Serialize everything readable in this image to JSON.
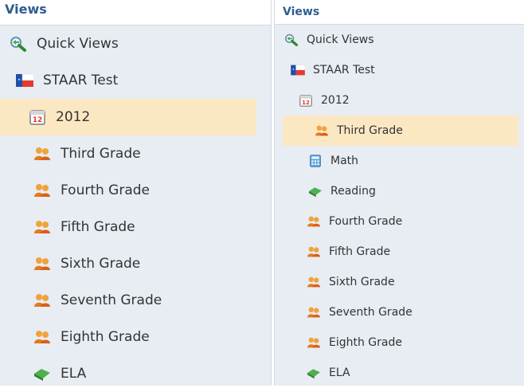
{
  "left": {
    "header": "Views",
    "items": [
      {
        "label": "Quick Views",
        "icon": "magnifier-icon"
      },
      {
        "label": "STAAR Test",
        "icon": "texas-flag-icon"
      },
      {
        "label": "2012",
        "icon": "calendar-icon",
        "selected": true
      },
      {
        "label": "Third Grade",
        "icon": "users-icon"
      },
      {
        "label": "Fourth Grade",
        "icon": "users-icon"
      },
      {
        "label": "Fifth Grade",
        "icon": "users-icon"
      },
      {
        "label": "Sixth Grade",
        "icon": "users-icon"
      },
      {
        "label": "Seventh Grade",
        "icon": "users-icon"
      },
      {
        "label": "Eighth Grade",
        "icon": "users-icon"
      },
      {
        "label": "ELA",
        "icon": "book-icon"
      }
    ]
  },
  "right": {
    "header": "Views",
    "items": [
      {
        "label": "Quick Views",
        "icon": "magnifier-icon"
      },
      {
        "label": "STAAR Test",
        "icon": "texas-flag-icon"
      },
      {
        "label": "2012",
        "icon": "calendar-icon"
      },
      {
        "label": "Third Grade",
        "icon": "users-icon",
        "selected": true
      },
      {
        "label": "Math",
        "icon": "calculator-icon"
      },
      {
        "label": "Reading",
        "icon": "book-icon"
      },
      {
        "label": "Fourth Grade",
        "icon": "users-icon"
      },
      {
        "label": "Fifth Grade",
        "icon": "users-icon"
      },
      {
        "label": "Sixth Grade",
        "icon": "users-icon"
      },
      {
        "label": "Seventh Grade",
        "icon": "users-icon"
      },
      {
        "label": "Eighth Grade",
        "icon": "users-icon"
      },
      {
        "label": "ELA",
        "icon": "book-icon"
      }
    ]
  },
  "colors": {
    "panel_bg": "#e8ecf3",
    "header_text": "#2e5d8f",
    "selected_bg": "#fbe8c3"
  },
  "calendar_icon_text": "12"
}
